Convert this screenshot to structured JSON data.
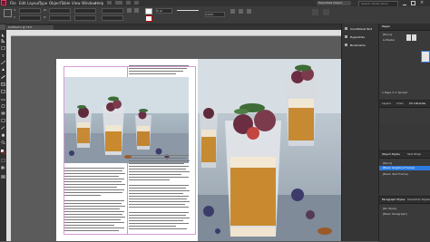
{
  "app": {
    "logo": "Id"
  },
  "menu": [
    "File",
    "Edit",
    "Layout",
    "Type",
    "Object",
    "Table",
    "View",
    "Window",
    "Help"
  ],
  "top_right": {
    "workspace": "Essentials Classic",
    "stock_search": "Search Adobe Stock"
  },
  "control": {
    "x_label": "X:",
    "y_label": "Y:",
    "w_label": "W:",
    "h_label": "H:",
    "zoom": "100%",
    "stroke_weight": "0 pt"
  },
  "doc_tab": "Untitled-1 @ 71%",
  "panels": {
    "collapsed": [
      "Conditional Text",
      "Hyperlinks",
      "Bookmarks"
    ],
    "pages": {
      "title": "Pages",
      "none": "[None]",
      "master": "A-Master",
      "footer": "1 Page in 1 Spread"
    },
    "layers": {
      "title": "Layers",
      "tab2": "Links",
      "tab3": "CC Libraries"
    },
    "object_styles": {
      "title": "Object Styles",
      "tab2": "Text Wrap"
    },
    "style_items": [
      "[None]",
      "[Basic Graphics Frame]",
      "[Basic Text Frame]"
    ],
    "paragraph": {
      "title": "Paragraph Styles",
      "tab2": "Character Styles"
    },
    "para_items": [
      "[No Style]",
      "[Basic Paragraph]"
    ]
  },
  "colors": {
    "accent": "#2d7be0",
    "panel": "#383838",
    "guide": "#b49fd7"
  },
  "icons": [
    "selection-tool-icon",
    "direct-select-icon",
    "type-tool-icon",
    "pen-tool-icon",
    "rectangle-frame-icon",
    "hand-tool-icon",
    "zoom-tool-icon"
  ]
}
